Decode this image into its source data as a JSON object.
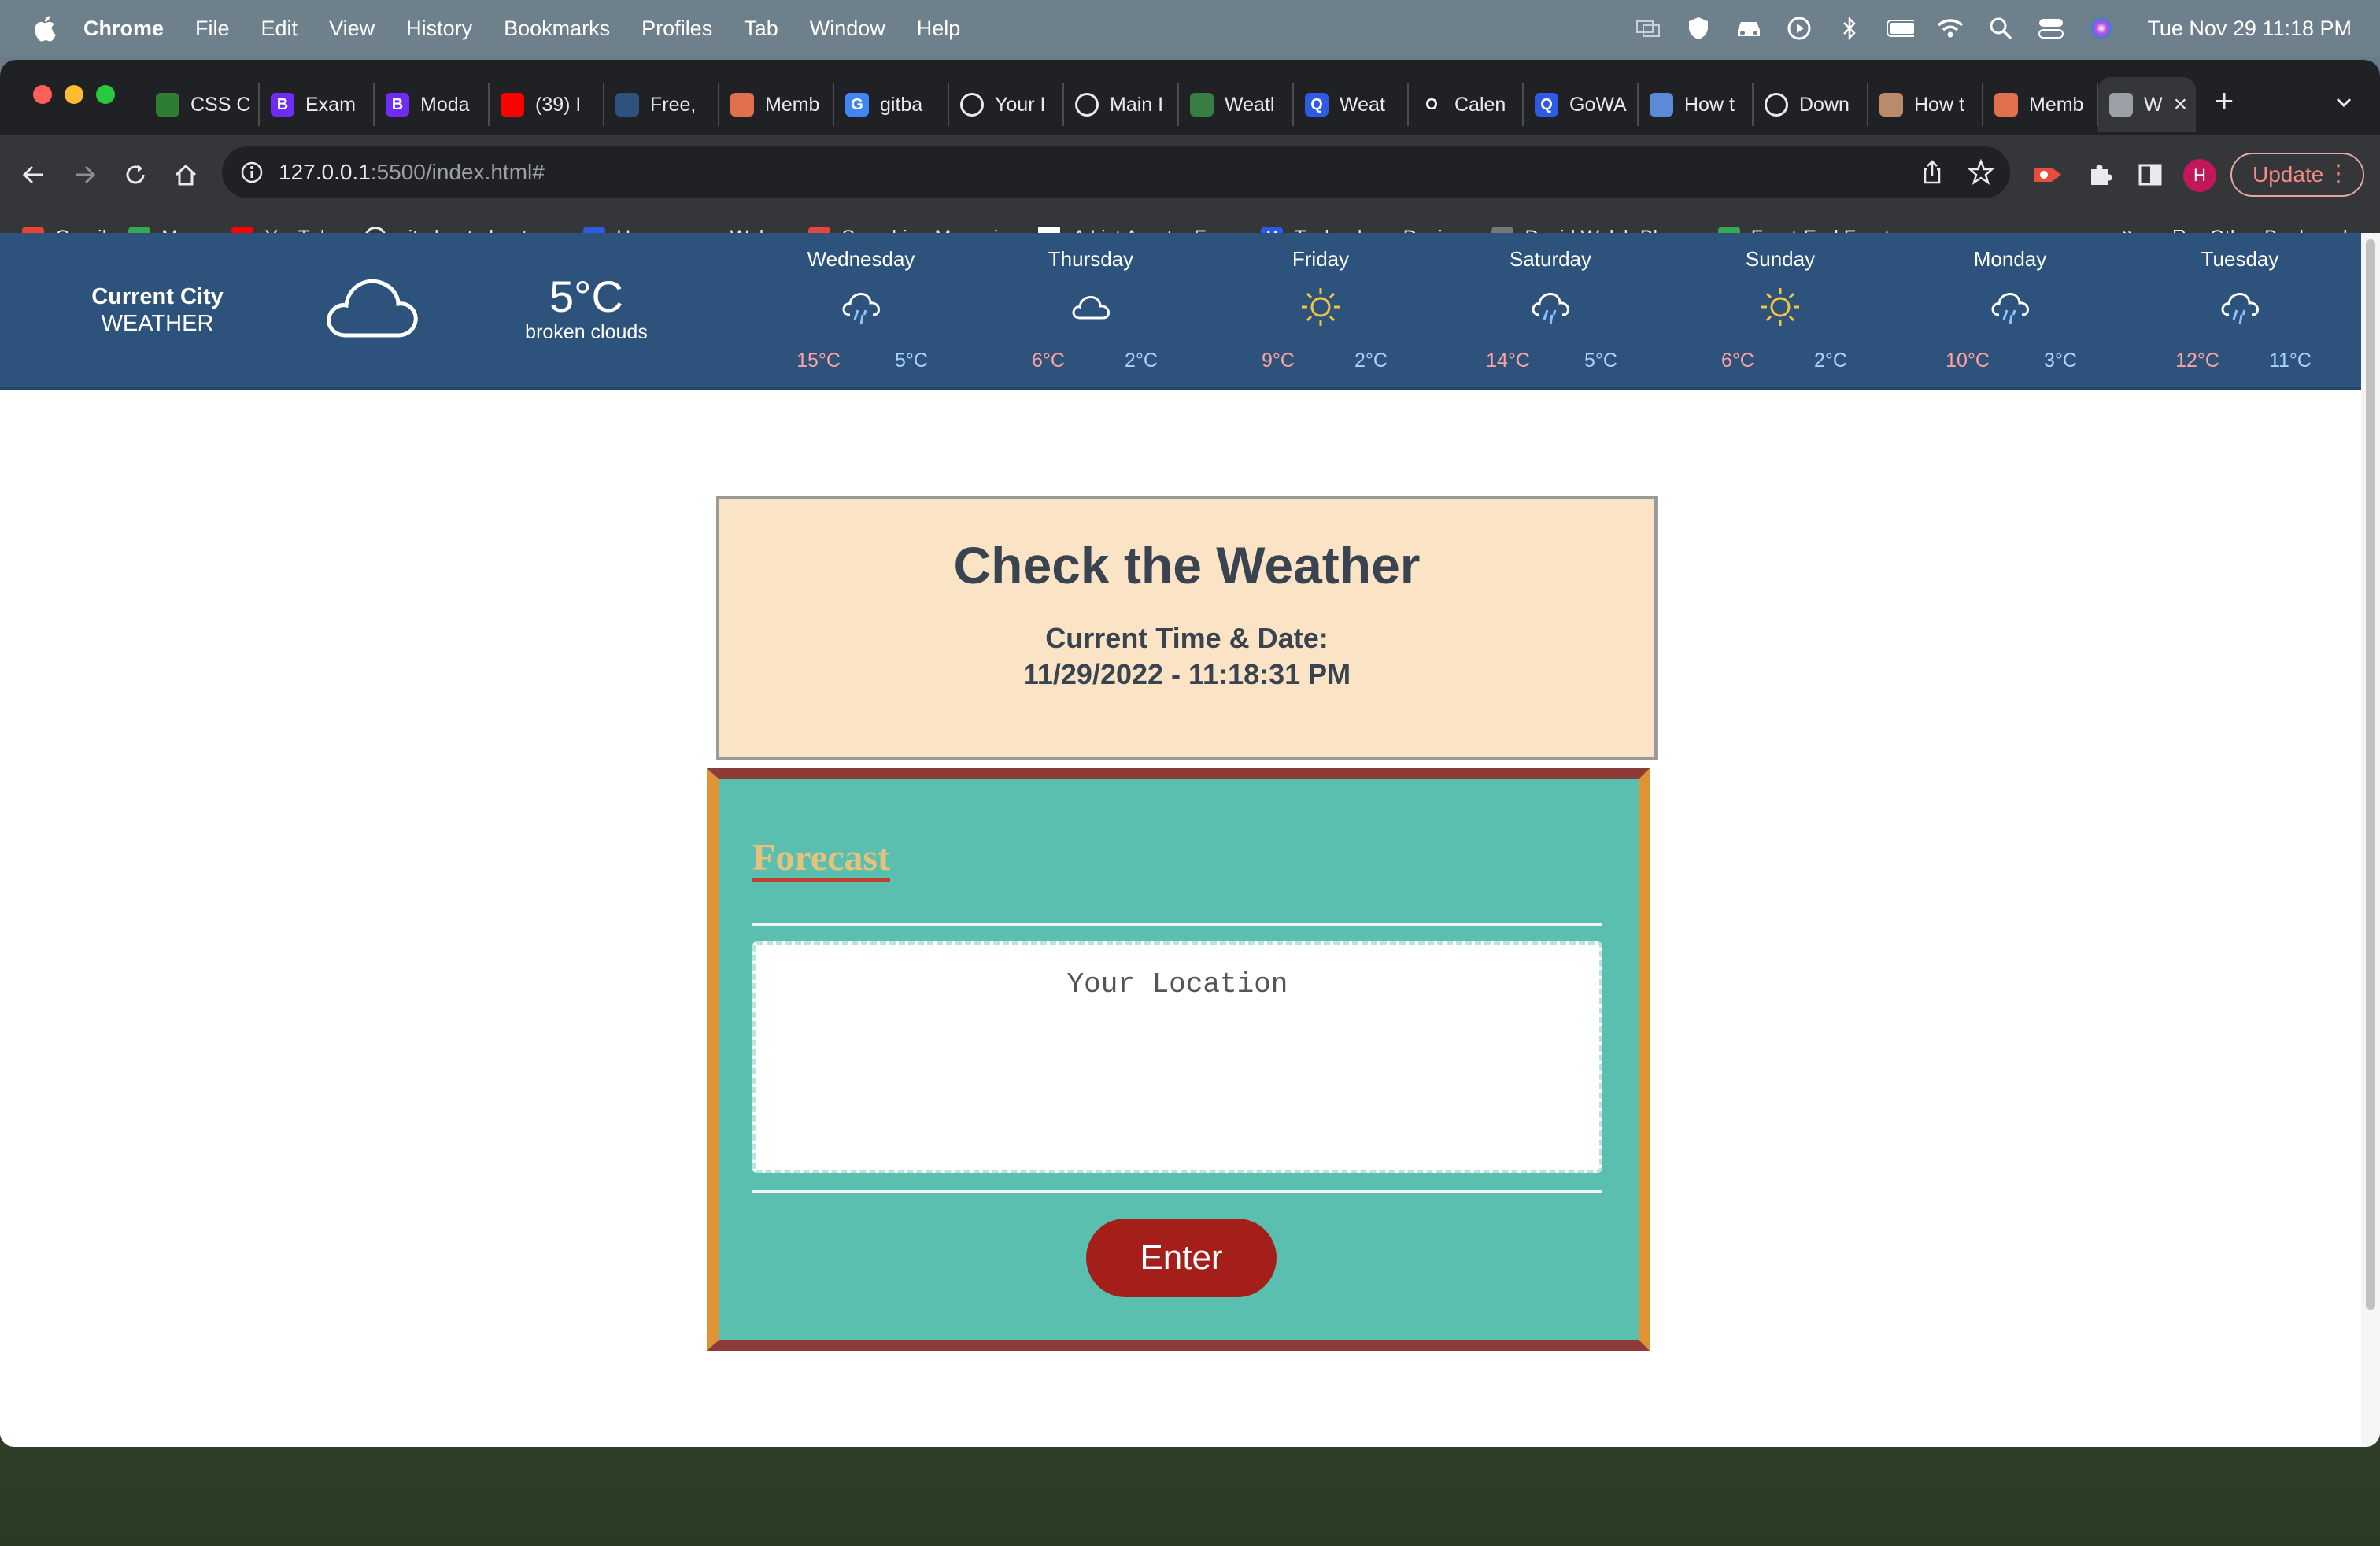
{
  "menubar": {
    "app": "Chrome",
    "items": [
      "File",
      "Edit",
      "View",
      "History",
      "Bookmarks",
      "Profiles",
      "Tab",
      "Window",
      "Help"
    ],
    "clock": "Tue Nov 29  11:18 PM"
  },
  "tabs": [
    {
      "title": "CSS C",
      "favicon": "w-icon",
      "color": "#2f7d32"
    },
    {
      "title": "Exam",
      "favicon": "B",
      "color": "#6f2cf5"
    },
    {
      "title": "Moda",
      "favicon": "B",
      "color": "#6f2cf5"
    },
    {
      "title": "(39) I",
      "favicon": "youtube-icon",
      "color": "#ff0000"
    },
    {
      "title": "Free,",
      "favicon": "cloud-icon",
      "color": "#2d527b"
    },
    {
      "title": "Memb",
      "favicon": "hat-icon",
      "color": "#e0714c"
    },
    {
      "title": "gitba",
      "favicon": "G",
      "color": "#4285f4"
    },
    {
      "title": "Your I",
      "favicon": "github-icon",
      "color": "#202124"
    },
    {
      "title": "Main I",
      "favicon": "github-icon",
      "color": "#202124"
    },
    {
      "title": "Weatl",
      "favicon": "weather-icon",
      "color": "#3a7d44"
    },
    {
      "title": "Weat",
      "favicon": "Q",
      "color": "#2d5be3"
    },
    {
      "title": "Calen",
      "favicon": "O",
      "color": "#202124"
    },
    {
      "title": "GoWA",
      "favicon": "Q",
      "color": "#2d5be3"
    },
    {
      "title": "How t",
      "favicon": "globe-icon",
      "color": "#5b8ad7"
    },
    {
      "title": "Down",
      "favicon": "download-icon",
      "color": "#202124"
    },
    {
      "title": "How t",
      "favicon": "face-icon",
      "color": "#b98b6a"
    },
    {
      "title": "Memb",
      "favicon": "hat-icon",
      "color": "#e0714c"
    },
    {
      "title": "W",
      "favicon": "globe-icon",
      "color": "#9aa0a6",
      "active": true
    }
  ],
  "address": {
    "host": "127.0.0.1",
    "path": ":5500/index.html#"
  },
  "toolbar": {
    "avatar": "H",
    "update": "Update"
  },
  "bookmarks": [
    {
      "label": "Gmail",
      "icon": "gmail-icon",
      "color": "#ea4335"
    },
    {
      "label": "Maps",
      "icon": "maps-icon",
      "color": "#34a853"
    },
    {
      "label": "YouTube",
      "icon": "youtube-icon",
      "color": "#ff0000"
    },
    {
      "label": "git-cheat-sheet-e...",
      "icon": "github-icon",
      "color": "#202124"
    },
    {
      "label": "Homepage - Web...",
      "icon": "w-icon",
      "color": "#2d5be3"
    },
    {
      "label": "Smashing Magazi...",
      "icon": "smashing-icon",
      "color": "#e8453c"
    },
    {
      "label": "A List Apart – For...",
      "icon": "alistapart-icon",
      "color": "#ffffff"
    },
    {
      "label": "Technology, Desig...",
      "icon": "H",
      "color": "#2d5be3"
    },
    {
      "label": "David Walsh Blog...",
      "icon": "dw-icon",
      "color": "#777777"
    },
    {
      "label": "Front-End Front —...",
      "icon": "frontend-icon",
      "color": "#34a853"
    }
  ],
  "bookmarks_more": "»",
  "bookmarks_other": "Other Bookmarks",
  "weather": {
    "city_line1": "Current City",
    "city_line2": "WEATHER",
    "current_icon": "cloud-icon",
    "temp": "5°C",
    "desc": "broken clouds",
    "days": [
      {
        "name": "Wednesday",
        "icon": "rain-icon",
        "hi": "15°C",
        "lo": "5°C"
      },
      {
        "name": "Thursday",
        "icon": "cloud-icon",
        "hi": "6°C",
        "lo": "2°C"
      },
      {
        "name": "Friday",
        "icon": "sun-icon",
        "hi": "9°C",
        "lo": "2°C"
      },
      {
        "name": "Saturday",
        "icon": "rain-icon",
        "hi": "14°C",
        "lo": "5°C"
      },
      {
        "name": "Sunday",
        "icon": "sun-icon",
        "hi": "6°C",
        "lo": "2°C"
      },
      {
        "name": "Monday",
        "icon": "rain-icon",
        "hi": "10°C",
        "lo": "3°C"
      },
      {
        "name": "Tuesday",
        "icon": "rain-icon",
        "hi": "12°C",
        "lo": "11°C"
      }
    ]
  },
  "main": {
    "title": "Check the Weather",
    "time_label": "Current Time & Date:",
    "time_value": "11/29/2022 - 11:18:31 PM",
    "forecast_label": "Forecast",
    "location_placeholder": "Your Location",
    "enter_label": "Enter"
  }
}
